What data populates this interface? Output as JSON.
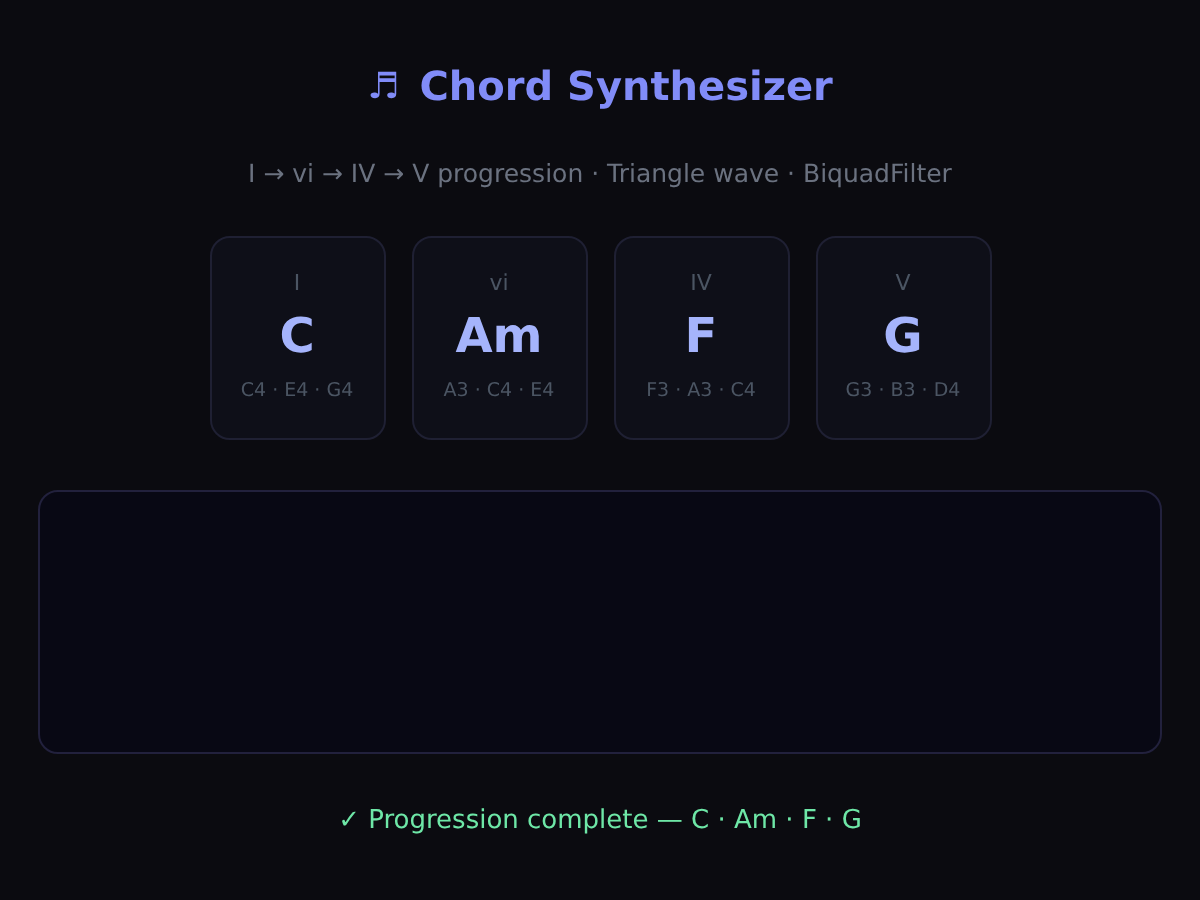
{
  "title": {
    "icon": "♬",
    "text": "Chord Synthesizer"
  },
  "subtitle": "I → vi → IV → V progression · Triangle wave · BiquadFilter",
  "chords": [
    {
      "numeral": "I",
      "name": "C",
      "notes": "C4 · E4 · G4"
    },
    {
      "numeral": "vi",
      "name": "Am",
      "notes": "A3 · C4 · E4"
    },
    {
      "numeral": "IV",
      "name": "F",
      "notes": "F3 · A3 · C4"
    },
    {
      "numeral": "V",
      "name": "G",
      "notes": "G3 · B3 · D4"
    }
  ],
  "status": "✓ Progression complete — C · Am · F · G"
}
